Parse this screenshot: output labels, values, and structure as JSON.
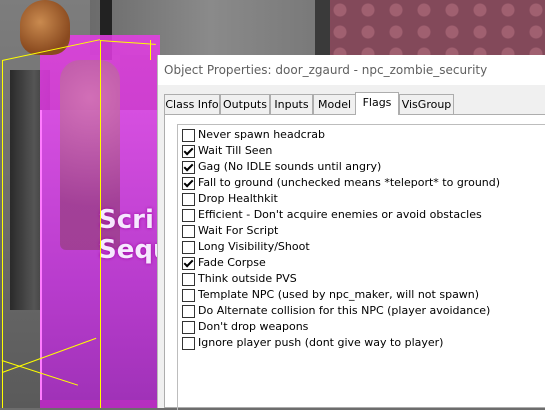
{
  "viewport": {
    "overlay_text": [
      "Scri",
      "Sequ"
    ],
    "accent_colors": {
      "selection": "#ffff00",
      "entity_box": "#d64fe0"
    }
  },
  "dialog": {
    "title": "Object Properties: door_zgaurd - npc_zombie_security",
    "tabs": [
      {
        "label": "Class Info",
        "active": false
      },
      {
        "label": "Outputs",
        "active": false
      },
      {
        "label": "Inputs",
        "active": false
      },
      {
        "label": "Model",
        "active": false
      },
      {
        "label": "Flags",
        "active": true
      },
      {
        "label": "VisGroup",
        "active": false
      }
    ],
    "flags": [
      {
        "label": "Never spawn headcrab",
        "checked": false
      },
      {
        "label": "Wait Till Seen",
        "checked": true
      },
      {
        "label": "Gag (No IDLE sounds until angry)",
        "checked": true
      },
      {
        "label": "Fall to ground (unchecked means *teleport* to ground)",
        "checked": true
      },
      {
        "label": "Drop Healthkit",
        "checked": false
      },
      {
        "label": "Efficient - Don't acquire enemies or avoid obstacles",
        "checked": false
      },
      {
        "label": "Wait For Script",
        "checked": false
      },
      {
        "label": "Long Visibility/Shoot",
        "checked": false
      },
      {
        "label": "Fade Corpse",
        "checked": true
      },
      {
        "label": "Think outside PVS",
        "checked": false
      },
      {
        "label": "Template NPC (used by npc_maker, will not spawn)",
        "checked": false
      },
      {
        "label": "Do Alternate collision for this NPC (player avoidance)",
        "checked": false
      },
      {
        "label": "Don't drop weapons",
        "checked": false
      },
      {
        "label": "Ignore player push (dont give way to player)",
        "checked": false
      }
    ]
  }
}
